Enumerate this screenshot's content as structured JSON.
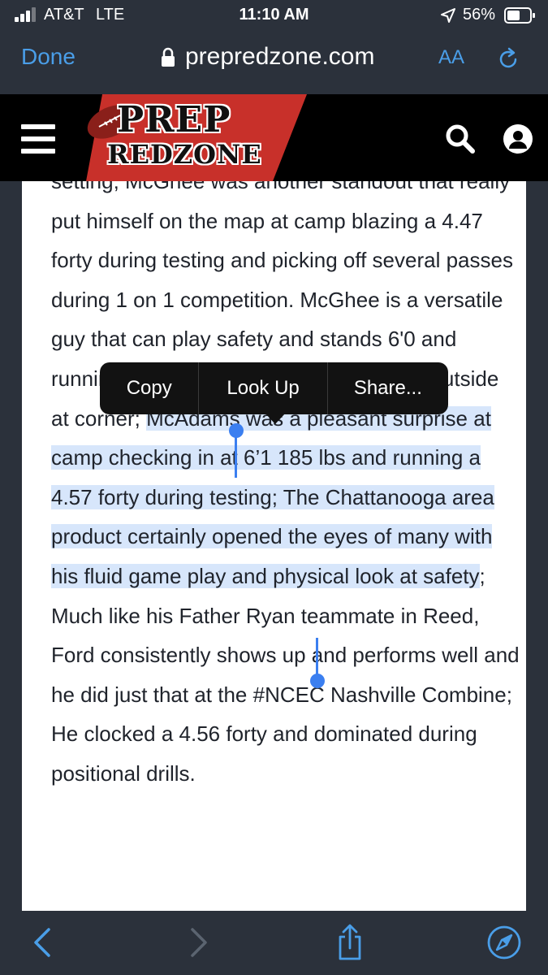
{
  "status_bar": {
    "carrier": "AT&T",
    "network": "LTE",
    "time": "11:10 AM",
    "battery_percent": "56%"
  },
  "url_bar": {
    "done_label": "Done",
    "domain": "prepredzone.com",
    "text_size_label": "AA"
  },
  "site_header": {
    "logo_line1": "PREP",
    "logo_line2": "REDZONE"
  },
  "article": {
    "text_before": "setting; McGhee was another standout that really put himself on the map at camp blazing a 4.47 forty during testing and picking off several passes during 1 on 1 competition. McGhee is a versatile guy that can play safety and stands 6'0 and running in the 4.4's shows he could stay outside at corner; ",
    "selected_text": "McAdams was a pleasant surprise at camp checking in at 6’1 185 lbs and running a 4.57 forty during testing; The Chattanooga area product certainly opened the eyes of many with his fluid game play and physical look at safety",
    "text_after": "; Much like his Father Ryan teammate in Reed, Ford consistently shows up and performs well and he did just that at the #NCEC Nashville Combine; He clocked a 4.56 forty and dominated during positional drills."
  },
  "context_menu": {
    "items": [
      "Copy",
      "Look Up",
      "Share..."
    ]
  },
  "toolbar": {
    "icons": [
      "back-icon",
      "forward-icon",
      "share-icon",
      "compass-icon"
    ]
  },
  "colors": {
    "accent": "#4a9ee8",
    "chrome_bg": "#2b313b",
    "selection": "#d7e6fb",
    "logo_red": "#c8302a"
  }
}
